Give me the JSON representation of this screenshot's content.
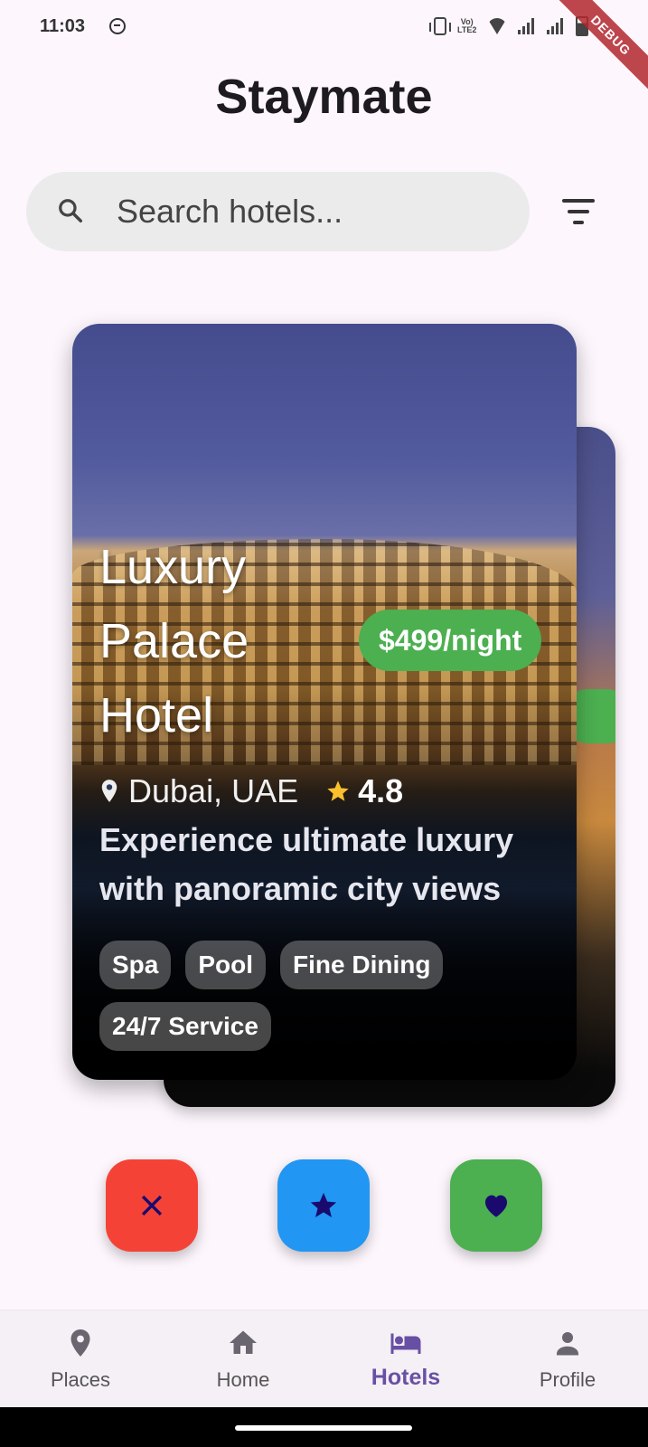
{
  "status_bar": {
    "time": "11:03",
    "lte_label": "Vo LTE2",
    "debug_label": "DEBUG"
  },
  "app": {
    "title": "Staymate"
  },
  "search": {
    "placeholder": "Search hotels...",
    "value": ""
  },
  "hotel": {
    "name": "Luxury Palace Hotel",
    "price": "$499/night",
    "location": "Dubai, UAE",
    "rating": "4.8",
    "description": "Experience ultimate luxury with panoramic city views",
    "amenities": [
      "Spa",
      "Pool",
      "Fine Dining",
      "24/7 Service"
    ]
  },
  "actions": {
    "dislike_icon": "close-icon",
    "super_like_icon": "star-icon",
    "like_icon": "heart-icon"
  },
  "nav": {
    "items": [
      {
        "label": "Places",
        "icon": "location-pin-icon",
        "active": false
      },
      {
        "label": "Home",
        "icon": "home-icon",
        "active": false
      },
      {
        "label": "Hotels",
        "icon": "bed-icon",
        "active": true
      },
      {
        "label": "Profile",
        "icon": "person-icon",
        "active": false
      }
    ]
  },
  "colors": {
    "accent": "#6750a4",
    "price_badge": "#4caf50",
    "dislike": "#f44336",
    "super_like": "#2196f3",
    "like": "#4caf50",
    "action_icon": "#1a0a6e",
    "star_rating": "#fbc02d"
  }
}
